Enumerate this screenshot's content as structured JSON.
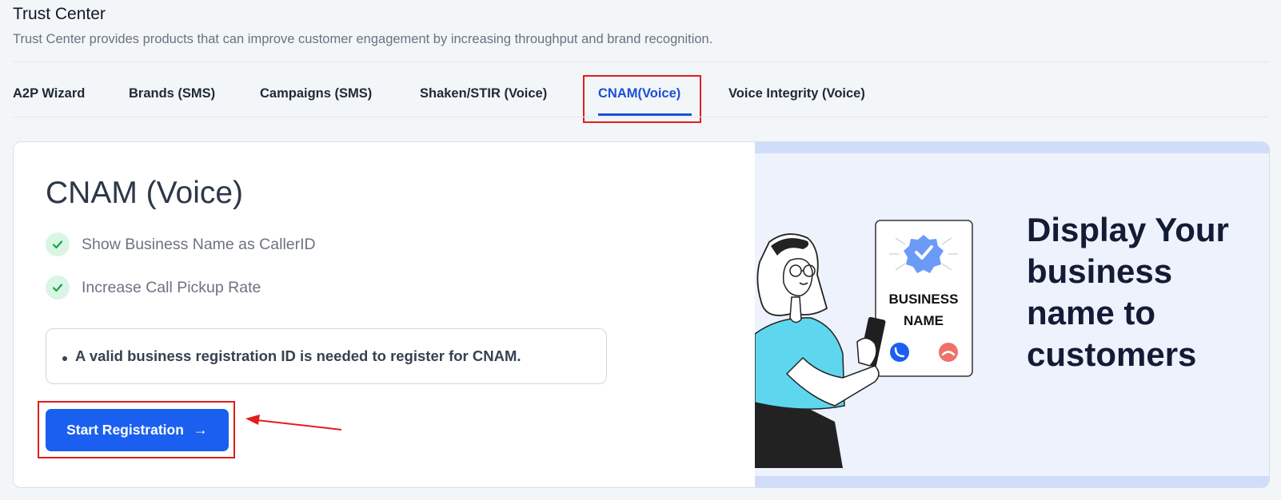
{
  "header": {
    "title": "Trust Center",
    "subtitle": "Trust Center provides products that can improve customer engagement by increasing throughput and brand recognition."
  },
  "tabs": [
    {
      "label": "A2P Wizard",
      "active": false
    },
    {
      "label": "Brands (SMS)",
      "active": false
    },
    {
      "label": "Campaigns (SMS)",
      "active": false
    },
    {
      "label": "Shaken/STIR (Voice)",
      "active": false
    },
    {
      "label": "CNAM(Voice)",
      "active": true
    },
    {
      "label": "Voice Integrity (Voice)",
      "active": false
    }
  ],
  "card": {
    "title": "CNAM (Voice)",
    "features": [
      "Show Business Name as CallerID",
      "Increase Call Pickup Rate"
    ],
    "notice": "A valid business registration ID is needed to register for CNAM.",
    "button_label": "Start Registration"
  },
  "promo": {
    "headline": "Display Your business name to customers",
    "phone_line1": "BUSINESS",
    "phone_line2": "NAME"
  },
  "colors": {
    "accent": "#1a5ff0",
    "active_tab": "#1d4ed8",
    "highlight": "#e11d1d",
    "check_bg": "#d8f6e3",
    "check": "#16a34a",
    "promo_bg": "#edf2fd"
  },
  "icons": [
    "check-icon",
    "arrow-right-icon",
    "verified-badge-icon",
    "phone-accept-icon",
    "phone-decline-icon"
  ]
}
